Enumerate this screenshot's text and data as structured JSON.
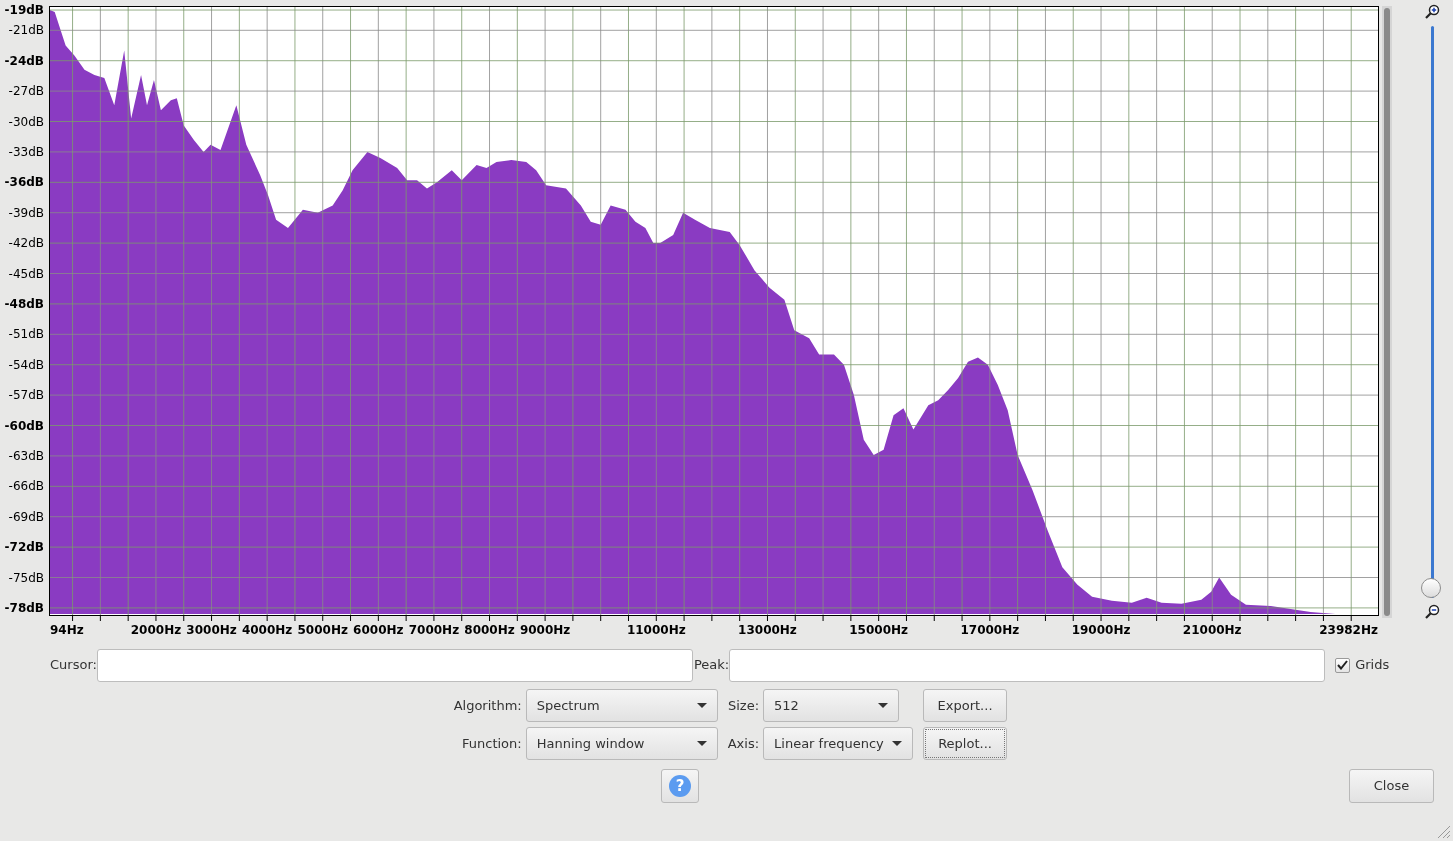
{
  "spectrum": {
    "chart_data": {
      "type": "area",
      "grid": true,
      "xlim": [
        94,
        23982
      ],
      "ylim": [
        -78.7,
        -18.7
      ],
      "xticks": [
        {
          "value": 94,
          "label": "94Hz"
        },
        {
          "value": 2000,
          "label": "2000Hz"
        },
        {
          "value": 3000,
          "label": "3000Hz"
        },
        {
          "value": 4000,
          "label": "4000Hz"
        },
        {
          "value": 5000,
          "label": "5000Hz"
        },
        {
          "value": 6000,
          "label": "6000Hz"
        },
        {
          "value": 7000,
          "label": "7000Hz"
        },
        {
          "value": 8000,
          "label": "8000Hz"
        },
        {
          "value": 9000,
          "label": "9000Hz"
        },
        {
          "value": 11000,
          "label": "11000Hz"
        },
        {
          "value": 13000,
          "label": "13000Hz"
        },
        {
          "value": 15000,
          "label": "15000Hz"
        },
        {
          "value": 17000,
          "label": "17000Hz"
        },
        {
          "value": 19000,
          "label": "19000Hz"
        },
        {
          "value": 21000,
          "label": "21000Hz"
        },
        {
          "value": 23982,
          "label": "23982Hz"
        }
      ],
      "yticks": [
        {
          "value": -19,
          "label": "-19dB"
        },
        {
          "value": -21,
          "label": "-21dB"
        },
        {
          "value": -24,
          "label": "-24dB"
        },
        {
          "value": -27,
          "label": "-27dB"
        },
        {
          "value": -30,
          "label": "-30dB"
        },
        {
          "value": -33,
          "label": "-33dB"
        },
        {
          "value": -36,
          "label": "-36dB"
        },
        {
          "value": -39,
          "label": "-39dB"
        },
        {
          "value": -42,
          "label": "-42dB"
        },
        {
          "value": -45,
          "label": "-45dB"
        },
        {
          "value": -48,
          "label": "-48dB"
        },
        {
          "value": -51,
          "label": "-51dB"
        },
        {
          "value": -54,
          "label": "-54dB"
        },
        {
          "value": -57,
          "label": "-57dB"
        },
        {
          "value": -60,
          "label": "-60dB"
        },
        {
          "value": -63,
          "label": "-63dB"
        },
        {
          "value": -66,
          "label": "-66dB"
        },
        {
          "value": -69,
          "label": "-69dB"
        },
        {
          "value": -72,
          "label": "-72dB"
        },
        {
          "value": -75,
          "label": "-75dB"
        },
        {
          "value": -78,
          "label": "-78dB"
        }
      ],
      "x": [
        94,
        94,
        179,
        375,
        536,
        714,
        893,
        1071,
        1250,
        1429,
        1554,
        1732,
        1839,
        1964,
        2089,
        2268,
        2375,
        2500,
        2679,
        2857,
        2982,
        3161,
        3446,
        3625,
        3875,
        4018,
        4161,
        4375,
        4643,
        4911,
        5179,
        5357,
        5536,
        5804,
        6036,
        6339,
        6518,
        6696,
        6875,
        7054,
        7321,
        7500,
        7768,
        7946,
        8125,
        8393,
        8661,
        8839,
        9018,
        9375,
        9643,
        9821,
        10000,
        10179,
        10446,
        10625,
        10804,
        10946,
        11071,
        11304,
        11482,
        11696,
        11964,
        12321,
        12500,
        12768,
        13036,
        13304,
        13482,
        13750,
        13929,
        14196,
        14375,
        14554,
        14732,
        14911,
        15089,
        15268,
        15446,
        15625,
        15893,
        16071,
        16250,
        16429,
        16607,
        16786,
        16964,
        17143,
        17321,
        17500,
        17768,
        18036,
        18304,
        18571,
        18839,
        19196,
        19554,
        19821,
        20089,
        20446,
        20804,
        20982,
        21125,
        21339,
        21607,
        22054,
        22768,
        23214,
        23800
      ],
      "series": [
        {
          "color": "#8a3bc2",
          "values": [
            -78.6,
            -19.0,
            -19.2,
            -22.5,
            -23.5,
            -24.9,
            -25.4,
            -25.7,
            -28.4,
            -23.0,
            -29.7,
            -25.4,
            -28.4,
            -25.9,
            -28.9,
            -27.9,
            -27.7,
            -30.4,
            -31.8,
            -33.0,
            -32.3,
            -32.8,
            -28.4,
            -32.3,
            -35.3,
            -37.3,
            -39.7,
            -40.5,
            -38.7,
            -39.0,
            -38.3,
            -36.8,
            -34.8,
            -33.0,
            -33.6,
            -34.6,
            -35.8,
            -35.8,
            -36.6,
            -36.0,
            -34.8,
            -35.8,
            -34.3,
            -34.6,
            -34.0,
            -33.8,
            -34.0,
            -34.8,
            -36.3,
            -36.6,
            -38.3,
            -39.9,
            -40.2,
            -38.3,
            -38.7,
            -39.9,
            -40.5,
            -42.0,
            -42.0,
            -41.2,
            -39.0,
            -39.7,
            -40.5,
            -40.9,
            -42.2,
            -44.7,
            -46.4,
            -47.6,
            -50.6,
            -51.4,
            -53.0,
            -53.0,
            -54.0,
            -57.0,
            -61.4,
            -62.9,
            -62.4,
            -59.0,
            -58.3,
            -60.4,
            -58.0,
            -57.5,
            -56.5,
            -55.3,
            -53.7,
            -53.3,
            -54.0,
            -56.0,
            -58.5,
            -62.9,
            -66.4,
            -70.3,
            -74.0,
            -75.7,
            -76.9,
            -77.3,
            -77.5,
            -77.0,
            -77.5,
            -77.6,
            -77.2,
            -76.4,
            -75.0,
            -76.7,
            -77.7,
            -77.8,
            -78.4,
            -78.6,
            -78.6
          ]
        }
      ]
    },
    "zoom_slider": {
      "level": 0
    }
  },
  "cursor": {
    "label": "Cursor:"
  },
  "peak": {
    "label": "Peak:"
  },
  "grids": {
    "label": "Grids",
    "checked": true
  },
  "algorithm": {
    "label": "Algorithm:",
    "value": "Spectrum"
  },
  "size": {
    "label": "Size:",
    "value": "512"
  },
  "export_button": "Export...",
  "function": {
    "label": "Function:",
    "value": "Hanning window"
  },
  "axis": {
    "label": "Axis:",
    "value": "Linear frequency"
  },
  "replot_button": "Replot...",
  "help_button": "?",
  "close_button": "Close"
}
